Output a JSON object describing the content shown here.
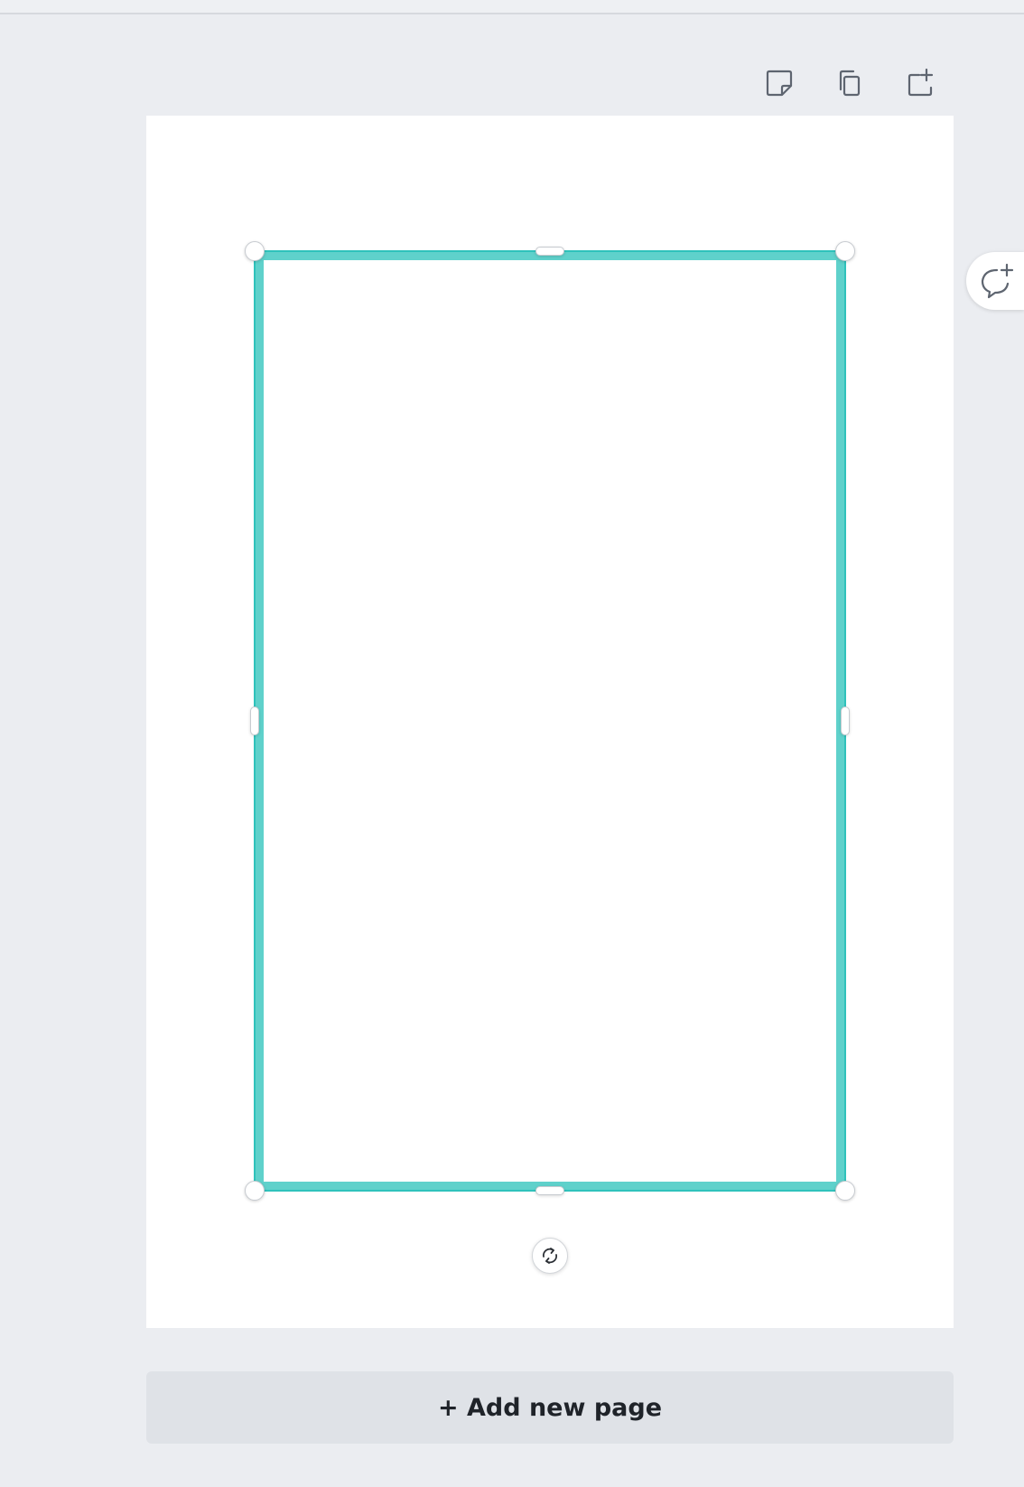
{
  "page_toolbar": {
    "icons": [
      "add-note-icon",
      "duplicate-page-icon",
      "add-page-after-icon"
    ]
  },
  "frame": {
    "border_color": "#5fd1cb",
    "selection_color": "#2fc2bb"
  },
  "rotate_handle": {
    "icon": "rotate-icon"
  },
  "comment": {
    "icon": "add-comment-icon"
  },
  "add_page": {
    "label": "+ Add new page"
  },
  "colors": {
    "workspace_background": "#ebedf1",
    "page_background": "#ffffff",
    "add_page_background": "#dfe2e7",
    "icon_color": "#5e6570"
  }
}
